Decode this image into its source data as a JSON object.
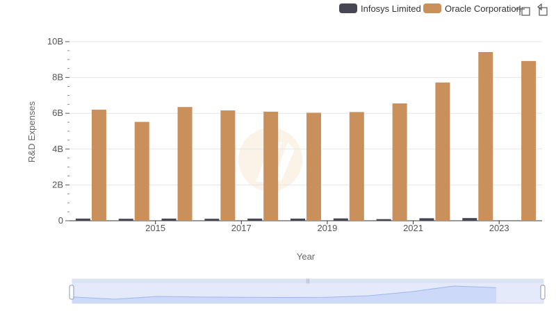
{
  "chart_data": {
    "type": "bar",
    "categories": [
      "2014",
      "2015",
      "2016",
      "2017",
      "2018",
      "2019",
      "2020",
      "2021",
      "2022",
      "2023",
      "2024"
    ],
    "x_tick_labels": [
      "2015",
      "2017",
      "2019",
      "2021",
      "2023"
    ],
    "y_tick_labels": [
      "0",
      "2B",
      "4B",
      "6B",
      "8B",
      "10B"
    ],
    "y_ticks": [
      0,
      2000000000,
      4000000000,
      6000000000,
      8000000000,
      10000000000
    ],
    "ylim": [
      0,
      10000000000
    ],
    "xlabel": "Year",
    "ylabel": "R&D Expenses",
    "grid": true,
    "legend_position": "top-right",
    "series": [
      {
        "name": "Infosys Limited",
        "color": "#464655",
        "values": [
          120000000,
          110000000,
          120000000,
          110000000,
          120000000,
          120000000,
          130000000,
          90000000,
          140000000,
          150000000,
          null
        ]
      },
      {
        "name": "Oracle Corporation",
        "color": "#c9905c",
        "values": [
          6200000000,
          5520000000,
          6350000000,
          6160000000,
          6090000000,
          6030000000,
          6070000000,
          6550000000,
          7720000000,
          9420000000,
          8920000000
        ]
      }
    ]
  },
  "toolbar": {
    "zoom_icon": "zoom-icon",
    "reset_icon": "reset-icon"
  }
}
